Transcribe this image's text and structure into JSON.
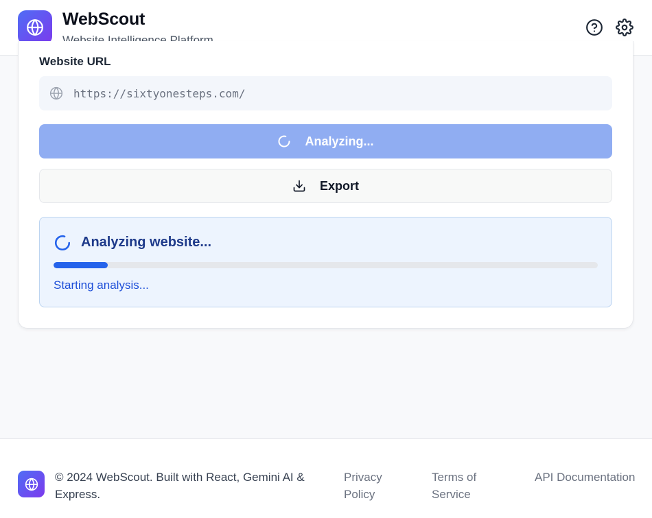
{
  "header": {
    "title": "WebScout",
    "subtitle": "Website Intelligence Platform",
    "logo_icon": "globe-icon",
    "help_icon": "help-circle-icon",
    "settings_icon": "gear-icon"
  },
  "form": {
    "url_label": "Website URL",
    "url_value": "https://sixtyonesteps.com/",
    "url_icon": "globe-icon",
    "analyze_label": "Analyzing...",
    "analyze_icon": "spinner-icon",
    "export_label": "Export",
    "export_icon": "download-icon"
  },
  "progress": {
    "title": "Analyzing website...",
    "status": "Starting analysis...",
    "percent": 10
  },
  "footer": {
    "copyright": "© 2024 WebScout. Built with React, Gemini AI & Express.",
    "links": [
      "Privacy Policy",
      "Terms of Service",
      "API Documentation"
    ]
  },
  "colors": {
    "brand_gradient_start": "#4f6df5",
    "brand_gradient_end": "#7c3aed",
    "analyze_button": "#90adf2",
    "progress_fill": "#2563eb",
    "progress_title": "#1e3a8a",
    "progress_panel_bg": "#edf4fe"
  }
}
